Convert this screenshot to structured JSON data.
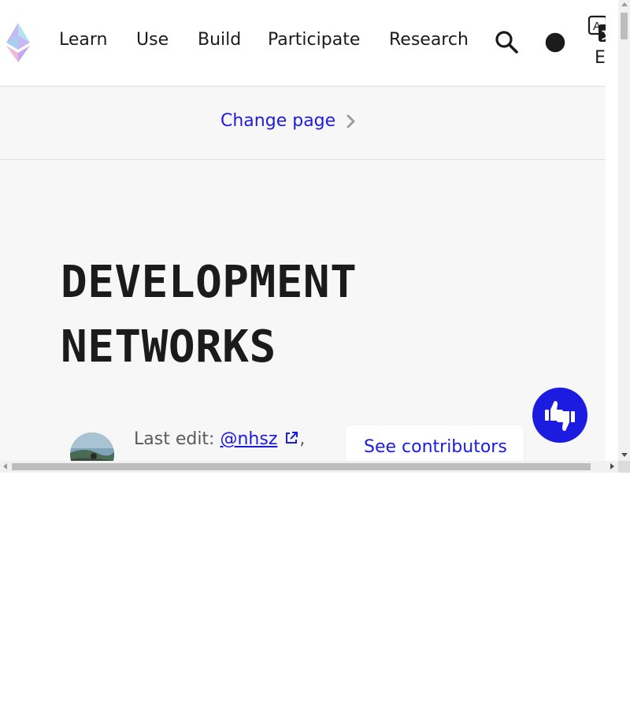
{
  "header": {
    "nav": [
      "Learn",
      "Use",
      "Build",
      "Participate",
      "Research"
    ],
    "language_code": "EN",
    "icons": {
      "logo": "ethereum-logo-icon",
      "search": "search-icon",
      "theme": "dark-mode-icon",
      "language": "translate-icon"
    }
  },
  "change_page": {
    "label": "Change page",
    "icon": "chevron-right-icon"
  },
  "page": {
    "title_line1": "DEVELOPMENT",
    "title_line2": "NETWORKS"
  },
  "meta": {
    "last_edit_prefix": "Last edit:",
    "editor_handle": "@nhsz",
    "suffix": ",",
    "contributors_button": "See contributors"
  },
  "feedback": {
    "icon": "thumbs-up-down-icon"
  },
  "colors": {
    "accent": "#1c1ce1",
    "background": "#f7f7f7",
    "text": "#1b1b1b"
  }
}
